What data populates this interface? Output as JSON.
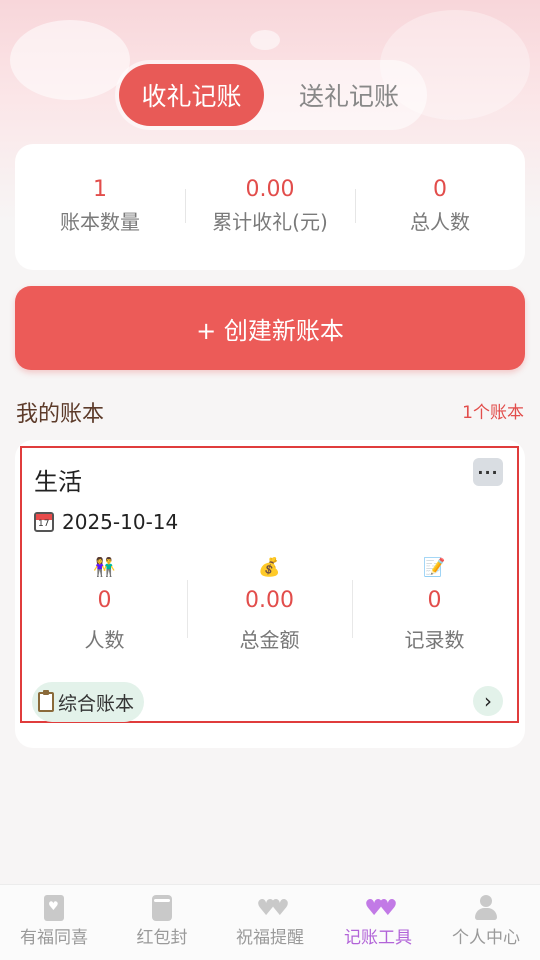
{
  "tabs": {
    "active_label": "收礼记账",
    "inactive_label": "送礼记账"
  },
  "stats": [
    {
      "value": "1",
      "label": "账本数量"
    },
    {
      "value": "0.00",
      "label": "累计收礼(元)"
    },
    {
      "value": "0",
      "label": "总人数"
    }
  ],
  "create_button": {
    "label": "+ 创建新账本"
  },
  "section": {
    "title": "我的账本",
    "count": "1个账本"
  },
  "book": {
    "name": "生活",
    "date": "2025-10-14",
    "metrics": [
      {
        "icon": "people-icon",
        "glyph": "👫",
        "value": "0",
        "label": "人数"
      },
      {
        "icon": "money-bag-icon",
        "glyph": "💰",
        "value": "0.00",
        "label": "总金额"
      },
      {
        "icon": "memo-icon",
        "glyph": "📝",
        "value": "0",
        "label": "记录数"
      }
    ],
    "tag": "综合账本",
    "more_label": "···",
    "chevron": "›"
  },
  "bottom_nav": [
    {
      "label": "有福同喜",
      "icon": "greeting-card-icon",
      "active": false
    },
    {
      "label": "红包封",
      "icon": "envelope-icon",
      "active": false
    },
    {
      "label": "祝福提醒",
      "icon": "hearts-icon",
      "active": false
    },
    {
      "label": "记账工具",
      "icon": "hearts-icon",
      "active": true
    },
    {
      "label": "个人中心",
      "icon": "person-icon",
      "active": false
    }
  ],
  "colors": {
    "accent": "#e85a57",
    "value_red": "#e24d4b",
    "nav_active": "#b264d8",
    "tag_bg": "#e3f2ea"
  }
}
